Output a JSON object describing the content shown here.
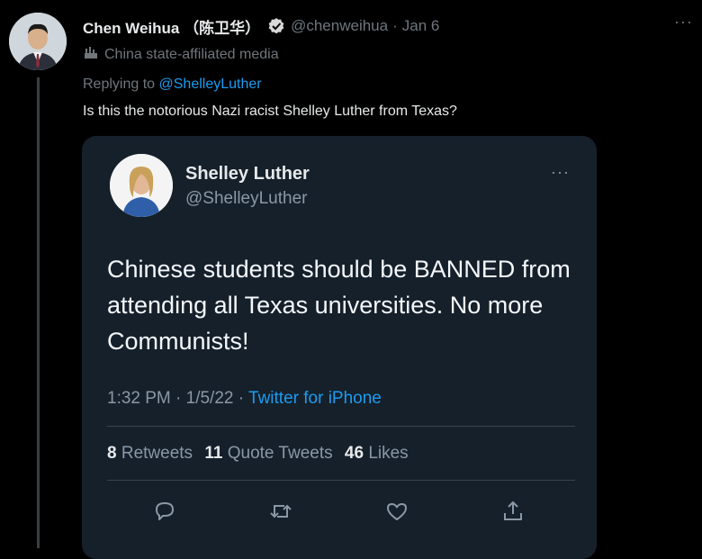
{
  "tweet": {
    "author_name": "Chen Weihua （陈卫华）",
    "handle": "@chenweihua",
    "separator": "·",
    "date": "Jan 6",
    "more_glyph": "···",
    "label": "China state-affiliated media",
    "replying_prefix": "Replying to",
    "replying_mention": "@ShelleyLuther",
    "text": "Is this the notorious Nazi racist Shelley Luther from Texas?"
  },
  "quoted": {
    "name": "Shelley Luther",
    "handle": "@ShelleyLuther",
    "more_glyph": "···",
    "text": "Chinese students should be BANNED from attending all Texas universities. No more Communists!",
    "time": "1:32 PM · 1/5/22 · ",
    "source": "Twitter for iPhone",
    "stats": {
      "retweets_count": "8",
      "retweets_label": "Retweets",
      "quotes_count": "11",
      "quotes_label": "Quote Tweets",
      "likes_count": "46",
      "likes_label": "Likes"
    }
  },
  "colors": {
    "background": "#000000",
    "card": "#15202b",
    "link": "#1d9bf0",
    "muted": "#6e767d"
  },
  "icons": [
    "verified-badge-icon",
    "more-icon",
    "state-media-flag-icon",
    "reply-icon",
    "retweet-icon",
    "like-icon",
    "share-icon"
  ]
}
